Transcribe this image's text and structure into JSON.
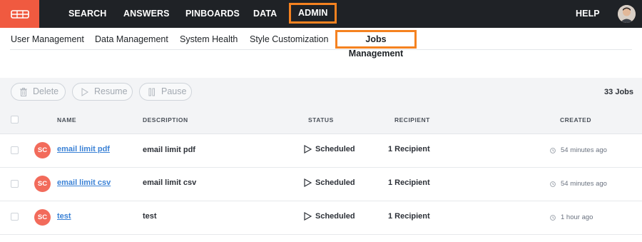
{
  "topnav": {
    "logo": "logo-icon",
    "items": [
      {
        "label": "SEARCH"
      },
      {
        "label": "ANSWERS"
      },
      {
        "label": "PINBOARDS"
      },
      {
        "label": "DATA"
      },
      {
        "label": "ADMIN"
      }
    ],
    "help": "HELP",
    "accent": "#f58220",
    "brand": "#f05a40"
  },
  "subnav": {
    "items": [
      {
        "label": "User Management"
      },
      {
        "label": "Data Management"
      },
      {
        "label": "System Health"
      },
      {
        "label": "Style Customization"
      },
      {
        "label": "Jobs Management"
      }
    ]
  },
  "toolbar": {
    "delete_label": "Delete",
    "resume_label": "Resume",
    "pause_label": "Pause",
    "job_count": "33 Jobs"
  },
  "table": {
    "columns": [
      "NAME",
      "DESCRIPTION",
      "STATUS",
      "RECIPIENT",
      "CREATED"
    ],
    "rows": [
      {
        "initials": "SC",
        "name": "email limit pdf",
        "description": "email limit pdf",
        "status": "Scheduled",
        "recipient": "1 Recipient",
        "created": "54 minutes ago"
      },
      {
        "initials": "SC",
        "name": "email limit csv",
        "description": "email limit csv",
        "status": "Scheduled",
        "recipient": "1 Recipient",
        "created": "54 minutes ago"
      },
      {
        "initials": "SC",
        "name": "test",
        "description": "test",
        "status": "Scheduled",
        "recipient": "1 Recipient",
        "created": "1 hour ago"
      }
    ]
  }
}
